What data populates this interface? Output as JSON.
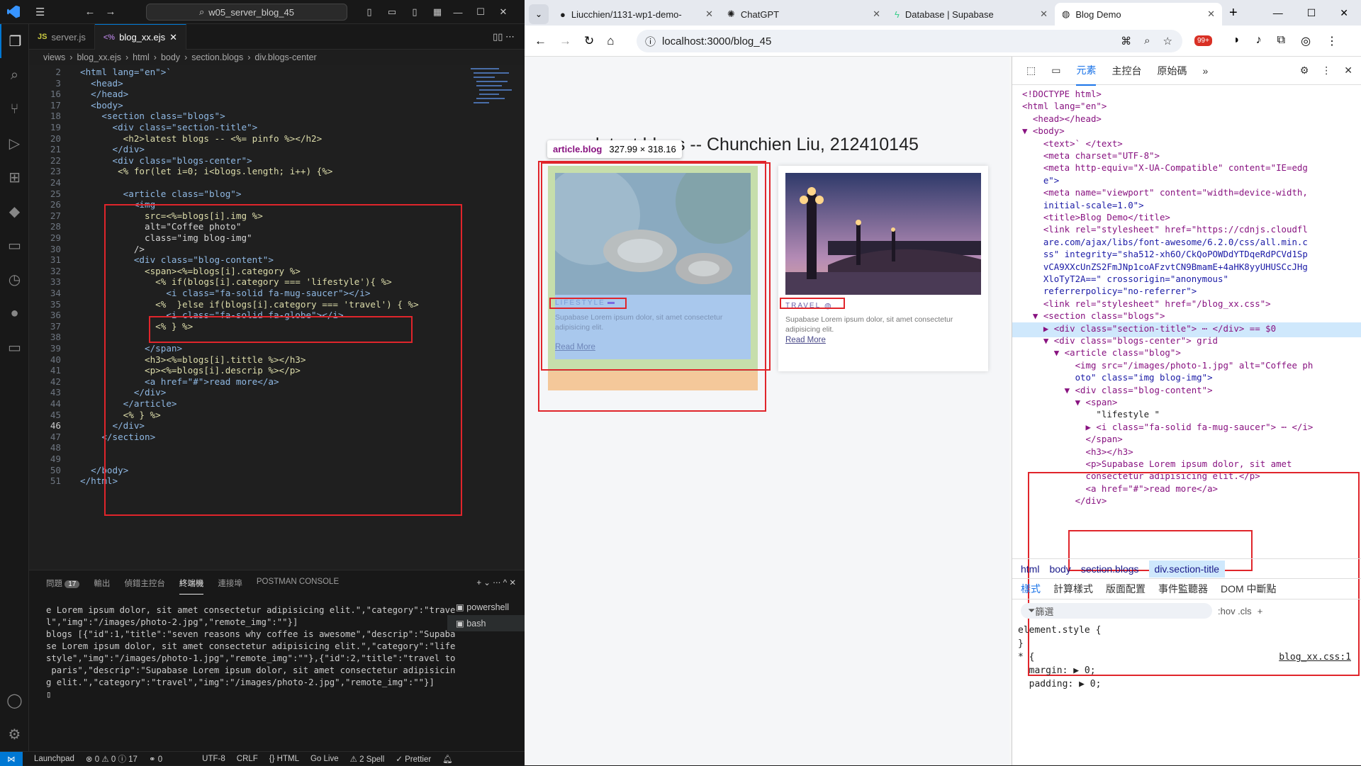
{
  "vscode": {
    "search": "w05_server_blog_45",
    "tabs": [
      {
        "label": "server.js",
        "badge": "JS"
      },
      {
        "label": "blog_xx.ejs",
        "badge": "<%"
      }
    ],
    "breadcrumb": [
      "views",
      "blog_xx.ejs",
      "html",
      "body",
      "section.blogs",
      "div.blogs-center"
    ],
    "line_numbers": [
      "2",
      "3",
      "16",
      "17",
      "18",
      "19",
      "20",
      "21",
      "22",
      "23",
      "24",
      "25",
      "26",
      "27",
      "28",
      "29",
      "30",
      "31",
      "32",
      "33",
      "34",
      "35",
      "36",
      "37",
      "38",
      "39",
      "40",
      "41",
      "42",
      "43",
      "44",
      "45",
      "46",
      "47",
      "48",
      "49",
      "50",
      "51"
    ],
    "code_lines": [
      "<html lang=\"en\">`",
      "  <head>",
      "  </head>",
      "  <body>",
      "    <section class=\"blogs\">",
      "      <div class=\"section-title\">",
      "        <h2>latest blogs -- <%= pinfo %></h2>",
      "      </div>",
      "      <div class=\"blogs-center\">",
      "       <% for(let i=0; i<blogs.length; i++) {%>",
      "",
      "        <article class=\"blog\">",
      "          <img",
      "            src=<%=blogs[i].img %>",
      "            alt=\"Coffee photo\"",
      "            class=\"img blog-img\"",
      "          />",
      "          <div class=\"blog-content\">",
      "            <span><%=blogs[i].category %>",
      "              <% if(blogs[i].category === 'lifestyle'){ %>",
      "                <i class=\"fa-solid fa-mug-saucer\"></i>",
      "              <%  }else if(blogs[i].category === 'travel') { %>",
      "                <i class=\"fa-solid fa-globe\"></i>",
      "              <% } %>",
      "",
      "            </span>",
      "            <h3><%=blogs[i].tittle %></h3>",
      "            <p><%=blogs[i].descrip %></p>",
      "            <a href=\"#\">read more</a>",
      "          </div>",
      "        </article>",
      "        <% } %>",
      "      </div>",
      "    </section>",
      "",
      "",
      "  </body>",
      "</html>"
    ],
    "panel_tabs": [
      "問題",
      "輸出",
      "偵錯主控台",
      "終端機",
      "連接埠",
      "POSTMAN CONSOLE"
    ],
    "problems_count": "17",
    "terminal": [
      "e Lorem ipsum dolor, sit amet consectetur adipisicing elit.\",\"category\":\"trave",
      "l\",\"img\":\"/images/photo-2.jpg\",\"remote_img\":\"\"}]",
      "blogs [{\"id\":1,\"title\":\"seven reasons why coffee is awesome\",\"descrip\":\"Supaba",
      "se Lorem ipsum dolor, sit amet consectetur adipisicing elit.\",\"category\":\"life",
      "style\",\"img\":\"/images/photo-1.jpg\",\"remote_img\":\"\"},{\"id\":2,\"title\":\"travel to",
      " paris\",\"descrip\":\"Supabase Lorem ipsum dolor, sit amet consectetur adipisicin",
      "g elit.\",\"category\":\"travel\",\"img\":\"/images/photo-2.jpg\",\"remote_img\":\"\"}]"
    ],
    "shells": [
      "powershell",
      "bash"
    ],
    "status": [
      "Launchpad",
      "⊗ 0 ⚠ 0 ⓘ 17",
      "⚭ 0",
      "UTF-8",
      "CRLF",
      "{} HTML",
      "Go Live",
      "⚠ 2 Spell",
      "✓ Prettier"
    ]
  },
  "browser": {
    "tabs": [
      "Liucchien/1131-wp1-demo-",
      "ChatGPT",
      "Database | Supabase",
      "Blog Demo"
    ],
    "url": "localhost:3000/blog_45",
    "ext_badge": "99+",
    "page_title": "latest blogs -- Chunchien Liu, 212410145",
    "tooltip": {
      "tag": "article.blog",
      "size": "327.99 × 318.16"
    },
    "cards": [
      {
        "tag": "LIFESTYLE",
        "desc": "Supabase Lorem ipsum dolor, sit amet consectetur adipisicing elit.",
        "link": "Read More"
      },
      {
        "tag": "TRAVEL",
        "desc": "Supabase Lorem ipsum dolor, sit amet consectetur adipisicing elit.",
        "link": "Read More"
      }
    ],
    "devtools": {
      "tabs": [
        "元素",
        "主控台",
        "原始碼"
      ],
      "dom_lines": [
        "<!DOCTYPE html>",
        "<html lang=\"en\">",
        "  <head></head>",
        "▼ <body>",
        "    <text>` </text>",
        "    <meta charset=\"UTF-8\">",
        "    <meta http-equiv=\"X-UA-Compatible\" content=\"IE=edg",
        "    e\">",
        "    <meta name=\"viewport\" content=\"width=device-width,",
        "    initial-scale=1.0\">",
        "    <title>Blog Demo</title>",
        "    <link rel=\"stylesheet\" href=\"https://cdnjs.cloudfl",
        "    are.com/ajax/libs/font-awesome/6.2.0/css/all.min.c",
        "    ss\" integrity=\"sha512-xh6O/CkQoPOWDdYTDqeRdPCVd1Sp",
        "    vCA9XXcUnZS2FmJNp1coAFzvtCN9BmamE+4aHK8yyUHUSCcJHg",
        "    XloTyT2A==\" crossorigin=\"anonymous\"",
        "    referrerpolicy=\"no-referrer\">",
        "    <link rel=\"stylesheet\" href=\"/blog_xx.css\">",
        "  ▼ <section class=\"blogs\">",
        "    ▶ <div class=\"section-title\"> ⋯ </div> == $0",
        "    ▼ <div class=\"blogs-center\"> grid",
        "      ▼ <article class=\"blog\">",
        "          <img src=\"/images/photo-1.jpg\" alt=\"Coffee ph",
        "          oto\" class=\"img blog-img\">",
        "        ▼ <div class=\"blog-content\">",
        "          ▼ <span>",
        "              \"lifestyle \"",
        "            ▶ <i class=\"fa-solid fa-mug-saucer\"> ⋯ </i>",
        "            </span>",
        "            <h3></h3>",
        "            <p>Supabase Lorem ipsum dolor, sit amet",
        "            consectetur adipisicing elit.</p>",
        "            <a href=\"#\">read more</a>",
        "          </div>"
      ],
      "crumbs": [
        "html",
        "body",
        "section.blogs",
        "div.section-title"
      ],
      "style_tabs": [
        "樣式",
        "計算樣式",
        "版面配置",
        "事件監聽器",
        "DOM 中斷點"
      ],
      "filter": "篩選",
      "filter_right": ":hov  .cls",
      "styles": [
        "element.style {",
        "}",
        "* {",
        "  margin: ▶ 0;",
        "  padding: ▶ 0;"
      ],
      "style_source": "blog_xx.css:1"
    }
  }
}
